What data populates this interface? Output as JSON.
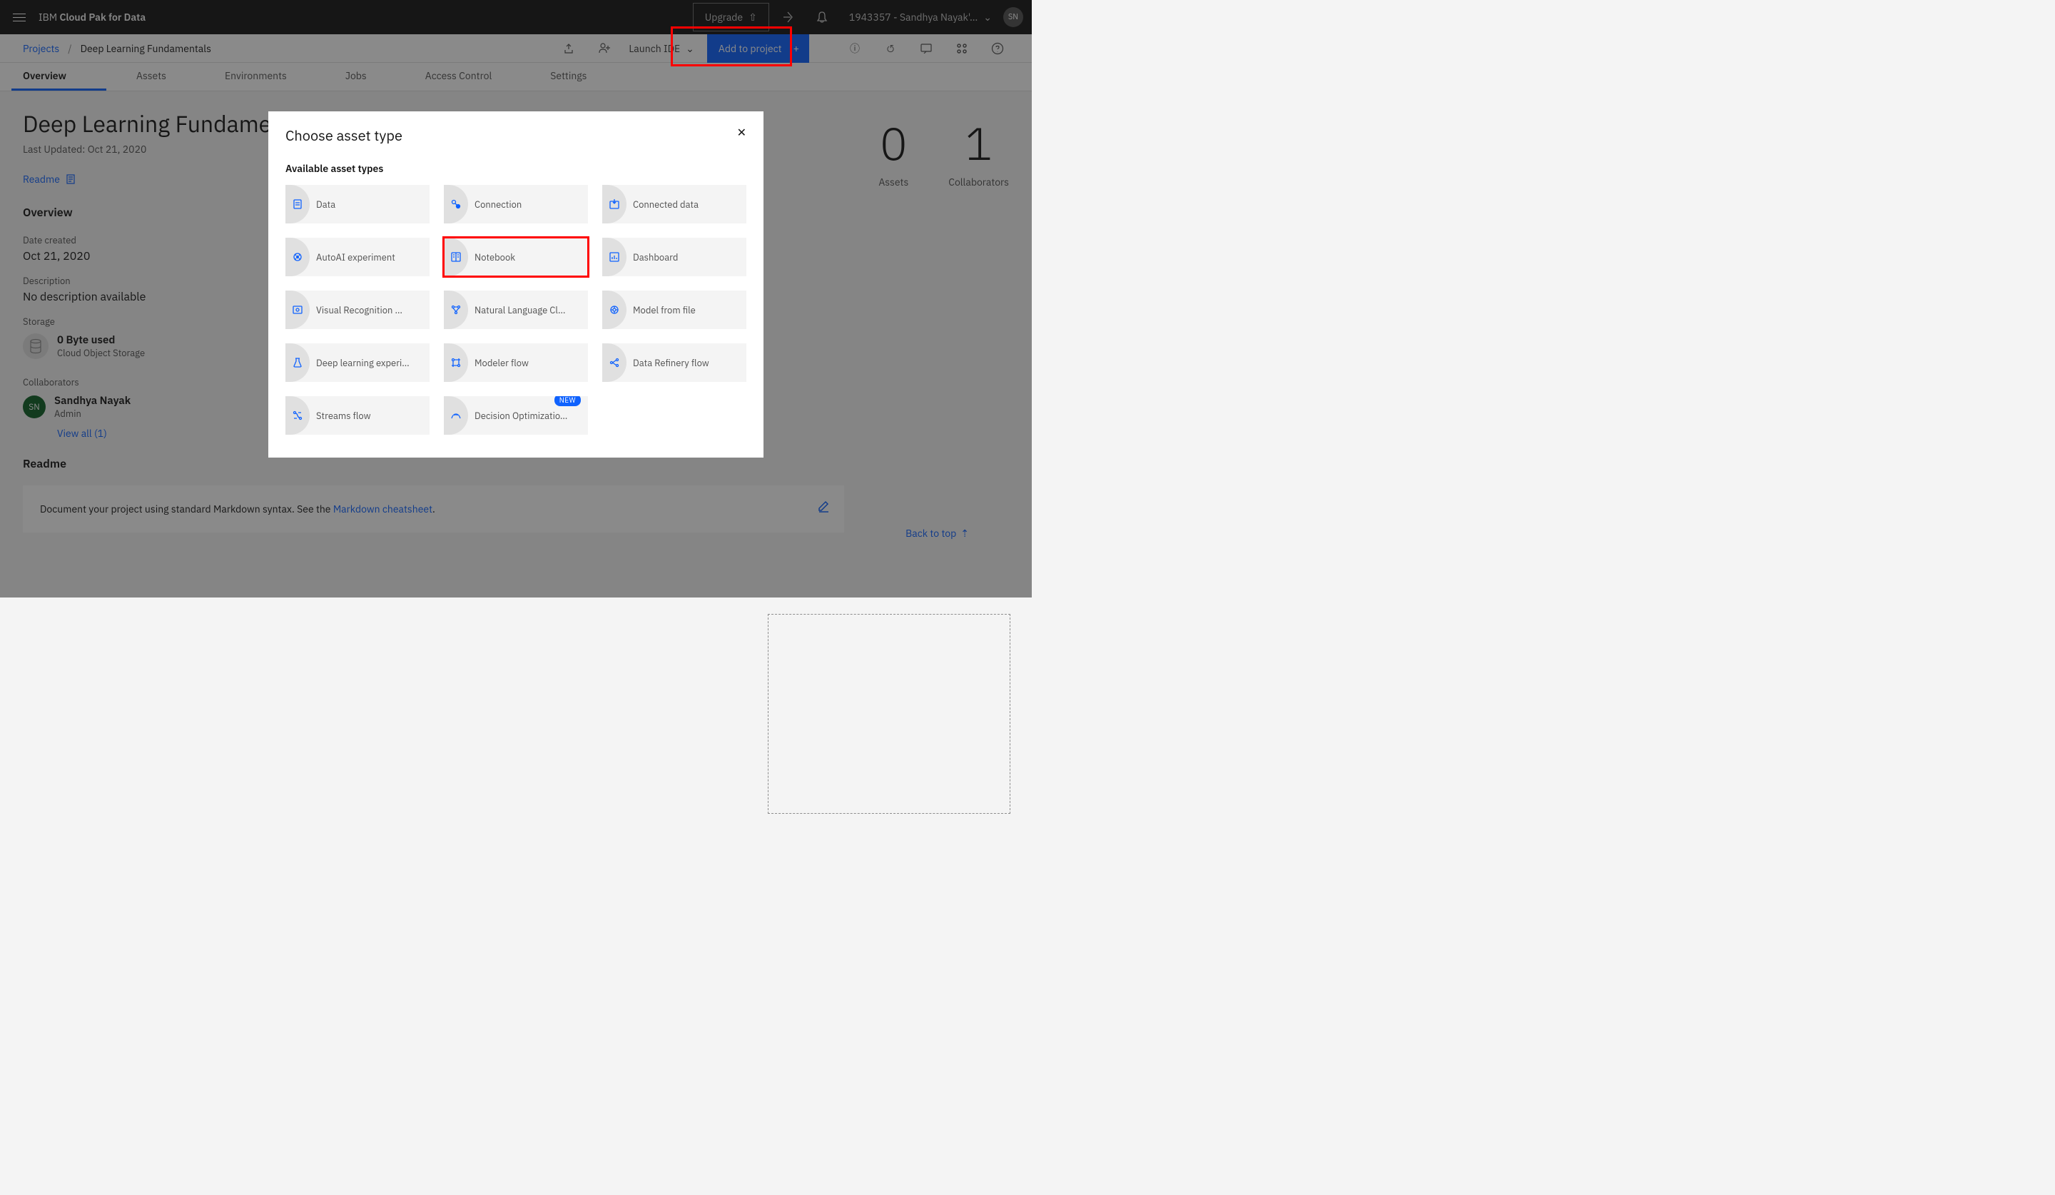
{
  "header": {
    "brand_prefix": "IBM",
    "brand": "Cloud Pak for Data",
    "upgrade_label": "Upgrade",
    "user_menu": "1943357 - Sandhya Nayak'…",
    "user_initials": "SN"
  },
  "breadcrumb": {
    "root": "Projects",
    "current": "Deep Learning Fundamentals",
    "launch_ide": "Launch IDE",
    "add_to_project": "Add to project"
  },
  "tabs": [
    "Overview",
    "Assets",
    "Environments",
    "Jobs",
    "Access Control",
    "Settings"
  ],
  "active_tab": 0,
  "project": {
    "title": "Deep Learning Fundamentals",
    "last_updated_label": "Last Updated:",
    "last_updated_value": "Oct 21, 2020",
    "readme_label": "Readme",
    "overview_heading": "Overview",
    "date_created_label": "Date created",
    "date_created_value": "Oct 21, 2020",
    "description_label": "Description",
    "description_value": "No description available",
    "storage_label": "Storage",
    "storage_used": "0 Byte used",
    "storage_service": "Cloud Object Storage",
    "collaborators_label": "Collaborators",
    "collaborator_name": "Sandhya Nayak",
    "collaborator_role": "Admin",
    "collaborator_initials": "SN",
    "view_all_label": "View all (1)",
    "readme_heading": "Readme",
    "readme_text_prefix": "Document your project using standard Markdown syntax. See the ",
    "readme_link": "Markdown cheatsheet",
    "readme_text_suffix": "."
  },
  "stats": {
    "assets_count": "0",
    "assets_label": "Assets",
    "collab_count": "1",
    "collab_label": "Collaborators"
  },
  "back_to_top": "Back to top",
  "modal": {
    "title": "Choose asset type",
    "subtitle": "Available asset types",
    "assets": [
      {
        "label": "Data",
        "icon": "file"
      },
      {
        "label": "Connection",
        "icon": "link"
      },
      {
        "label": "Connected data",
        "icon": "import"
      },
      {
        "label": "AutoAI experiment",
        "icon": "ai"
      },
      {
        "label": "Notebook",
        "icon": "book",
        "highlighted": true
      },
      {
        "label": "Dashboard",
        "icon": "chart"
      },
      {
        "label": "Visual Recognition …",
        "icon": "vision"
      },
      {
        "label": "Natural Language Cl…",
        "icon": "nlp"
      },
      {
        "label": "Model from file",
        "icon": "model"
      },
      {
        "label": "Deep learning experi…",
        "icon": "flask"
      },
      {
        "label": "Modeler flow",
        "icon": "flow"
      },
      {
        "label": "Data Refinery flow",
        "icon": "refinery"
      },
      {
        "label": "Streams flow",
        "icon": "stream"
      },
      {
        "label": "Decision Optimizatio…",
        "icon": "decision",
        "badge": "NEW"
      }
    ]
  }
}
